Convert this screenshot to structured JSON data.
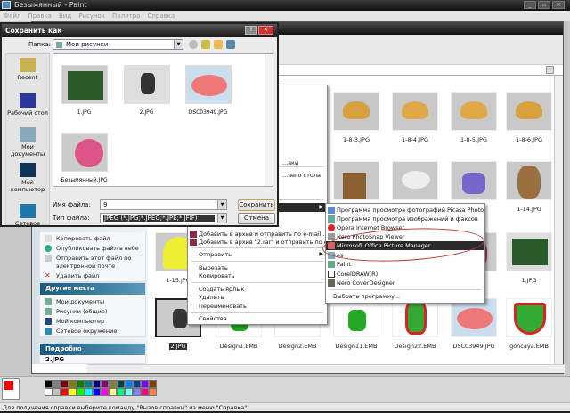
{
  "paint": {
    "title": "Безымянный - Paint",
    "menu": [
      "Файл",
      "Правка",
      "Вид",
      "Рисунок",
      "Палитра",
      "Справка"
    ],
    "status": "Для получения справки выберите команду \"Вызов справки\" из меню \"Справка\".",
    "palette_top": [
      "#000000",
      "#808080",
      "#800000",
      "#808000",
      "#008000",
      "#008080",
      "#000080",
      "#800080",
      "#808040",
      "#004040",
      "#0080ff",
      "#004080",
      "#8000ff",
      "#804000"
    ],
    "palette_bottom": [
      "#ffffff",
      "#c0c0c0",
      "#ff0000",
      "#ffff00",
      "#00ff00",
      "#00ffff",
      "#0000ff",
      "#ff00ff",
      "#ffff80",
      "#00ff80",
      "#80ffff",
      "#8080ff",
      "#ff0080",
      "#ff8040"
    ],
    "primary_color": "#ff0000"
  },
  "dialog": {
    "title": "Сохранить как",
    "help": "?",
    "close": "✕",
    "folder_label": "Папка:",
    "folder_value": "Мои рисунки",
    "places": [
      "Recent",
      "Рабочий стол",
      "Мои документы",
      "Мой компьютер",
      "Сетевое"
    ],
    "files": [
      "1.JPG",
      "2.JPG",
      "DSC03949.JPG",
      "Безымянный.JPG"
    ],
    "filename_label": "Имя файла:",
    "filename_value": "9",
    "filetype_label": "Тип файла:",
    "filetype_value": "JPEG (*.JPG;*.JPEG;*.JPE;*.JFIF)",
    "save": "Сохранить",
    "cancel": "Отмена"
  },
  "explorer": {
    "tasks": [
      "Копировать файл",
      "Опубликовать файл в вебе",
      "Отправить этот файл по электронной почте",
      "Удалить файл"
    ],
    "other_places": {
      "title": "Другие места",
      "items": [
        "Мои документы",
        "Рисунки (общие)",
        "Мой компьютер",
        "Сетевое окружение"
      ]
    },
    "details": {
      "title": "Подробно",
      "name": "2.JPG"
    },
    "thumbs_row1": [
      "1-8-3.JPG",
      "1-8-4.JPG",
      "1-8-5.JPG",
      "1-8-6.JPG"
    ],
    "thumbs_row2": [
      "13.JPG",
      "1-14.JPG"
    ],
    "thumbs_row3": [
      "1-15.JPG",
      "20.JPG",
      "1.JPG"
    ],
    "thumbs_row4": [
      "2.JPG",
      "Design1.EMB",
      "Design2.EMB",
      "Design11.EMB",
      "Design22.EMB",
      "DSC03949.JPG",
      "goncaya.EMB"
    ]
  },
  "context_menu": {
    "partial": [
      "...вки",
      "...чего стола"
    ],
    "items": [
      "Добавить в архив и отправить по e-mail...",
      "Добавить в архив \"2.rar\" и отправить по e-mail",
      "Отправить",
      "Вырезать",
      "Копировать",
      "Создать ярлык",
      "Удалить",
      "Переименовать",
      "Свойства"
    ]
  },
  "open_with": {
    "items": [
      "Программа просмотра фотографий Picasa Photo Viewer",
      "Программа просмотра изображений и факсов",
      "Opera Internet Browser",
      "Nero PhotoSnap Viewer",
      "Microsoft Office Picture Manager",
      "es",
      "Paint",
      "CorelDRAW(R)",
      "Nero CoverDesigner"
    ],
    "choose": "Выбрать программу..."
  }
}
